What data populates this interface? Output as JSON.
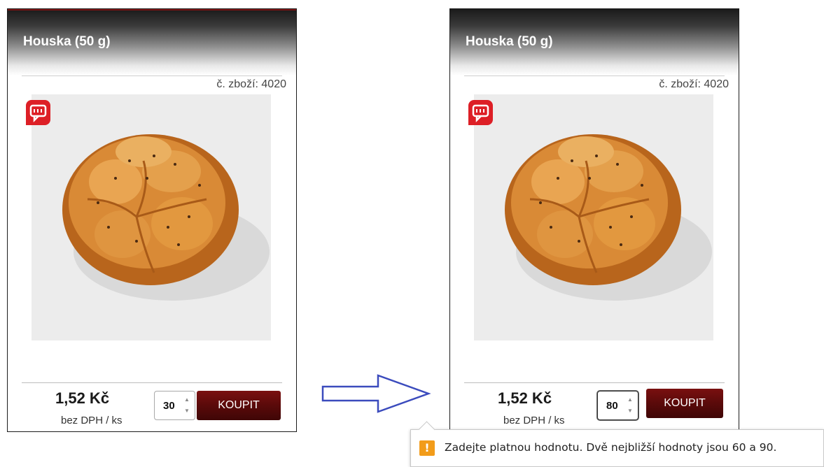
{
  "cards": [
    {
      "title": "Houska (50 g)",
      "product_number": "č. zboží: 4020",
      "price": "1,52 Kč",
      "price_unit": "bez DPH / ks",
      "quantity": "30",
      "buy_label": "KOUPIT"
    },
    {
      "title": "Houska (50 g)",
      "product_number": "č. zboží: 4020",
      "price": "1,52 Kč",
      "price_unit": "bez DPH / ks",
      "quantity": "80",
      "buy_label": "KOUPIT"
    }
  ],
  "validation_tooltip": {
    "icon": "warning-icon",
    "icon_glyph": "!",
    "message": "Zadejte platnou hodnotu. Dvě nejbližší hodnoty jsou 60 a 90."
  },
  "icons": {
    "comment": "comment-icon",
    "spin_up": "spin-up-icon",
    "spin_down": "spin-down-icon",
    "arrow": "arrow-right-icon"
  },
  "colors": {
    "accent_red": "#dd1f26",
    "button_dark_red": "#5a0a0a",
    "warning_orange": "#f29c1a",
    "arrow_blue": "#3b4bbd"
  }
}
